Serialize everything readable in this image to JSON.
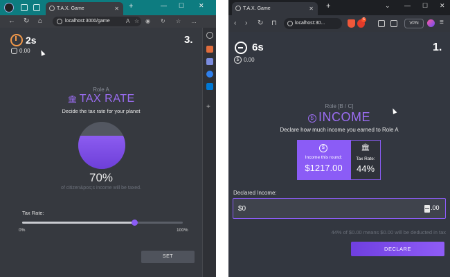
{
  "windowA": {
    "tab_title": "T.A.X. Game",
    "url": "localhost:3000/game",
    "timer": "2s",
    "coins": "0.00",
    "round": "3.",
    "role": "Role A",
    "title": "TAX RATE",
    "subtitle": "Decide the tax rate for your planet",
    "tax_rate_fraction": 0.7,
    "tax_rate_display": "70%",
    "note": "of citizen&pos;s income will be taxed.",
    "slider_label": "Tax Rate:",
    "slider_value_fraction": 0.7,
    "slider_min": "0%",
    "slider_max": "100%",
    "set_button": "SET",
    "icons": {
      "timer": "timer-icon",
      "coins": "coin-icon",
      "bank": "bank-icon"
    },
    "colors": {
      "accent": "#8b5cf6",
      "timer": "#f2994a"
    }
  },
  "windowB": {
    "tab_title": "T.A.X. Game",
    "url": "localhost:30...",
    "vpn_label": "VPN",
    "shield_badge": "6",
    "timer": "6s",
    "coins": "0.00",
    "round": "1.",
    "role": "Role [B / C]",
    "title": "INCOME",
    "subtitle": "Declare how much income you earned to Role A",
    "income_label": "Income this round:",
    "income_value": "$1217.00",
    "tax_label": "Tax Rate:",
    "tax_value": "44%",
    "field_label": "Declared Income:",
    "input_value": "$0",
    "input_suffix": ".00",
    "hint": "44% of $0.00 means $0.00 will be deducted in tax",
    "declare_button": "DECLARE",
    "icons": {
      "timer": "timer-icon",
      "coins": "dollar-icon",
      "bank": "bank-icon"
    },
    "colors": {
      "accent": "#8b5cf6"
    }
  }
}
